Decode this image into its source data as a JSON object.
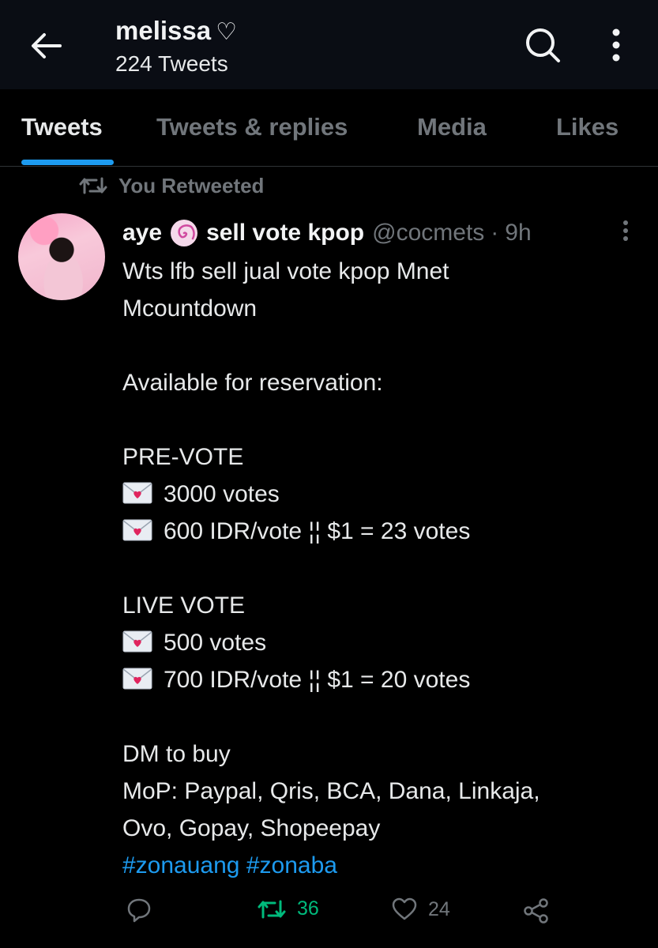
{
  "header": {
    "profile_name": "melissa",
    "name_emoji": "♡",
    "tweet_count": "224 Tweets"
  },
  "tabs": [
    {
      "label": "Tweets",
      "active": true
    },
    {
      "label": "Tweets & replies",
      "active": false
    },
    {
      "label": "Media",
      "active": false
    },
    {
      "label": "Likes",
      "active": false
    }
  ],
  "retweet_context": "You Retweeted",
  "tweet": {
    "author_name": "aye",
    "author_name_suffix": "sell vote kpop",
    "handle": "@cocmets",
    "separator": "·",
    "time": "9h",
    "lines": [
      "Wts lfb sell jual vote kpop Mnet",
      "Mcountdown",
      "",
      "Available for reservation:",
      "",
      "PRE-VOTE",
      "3000 votes",
      "600 IDR/vote ¦¦ $1 = 23 votes",
      "",
      "LIVE VOTE",
      "500 votes",
      "700 IDR/vote ¦¦ $1 = 20 votes",
      "",
      "DM to buy",
      "MoP: Paypal, Qris, BCA, Dana, Linkaja,",
      "Ovo, Gopay, Shopeepay"
    ],
    "hashtags": [
      "#zonauang",
      "#zonaba"
    ],
    "retweet_count": "36",
    "like_count": "24"
  },
  "colors": {
    "accent": "#1d9bf0",
    "retweet_green": "#00ba7c",
    "muted": "#71767b",
    "background": "#000000"
  },
  "icons": [
    "back-arrow-icon",
    "search-icon",
    "more-vertical-icon",
    "retweet-icon",
    "verified-swirl-icon",
    "love-letter-icon",
    "reply-icon",
    "like-icon",
    "share-icon"
  ]
}
